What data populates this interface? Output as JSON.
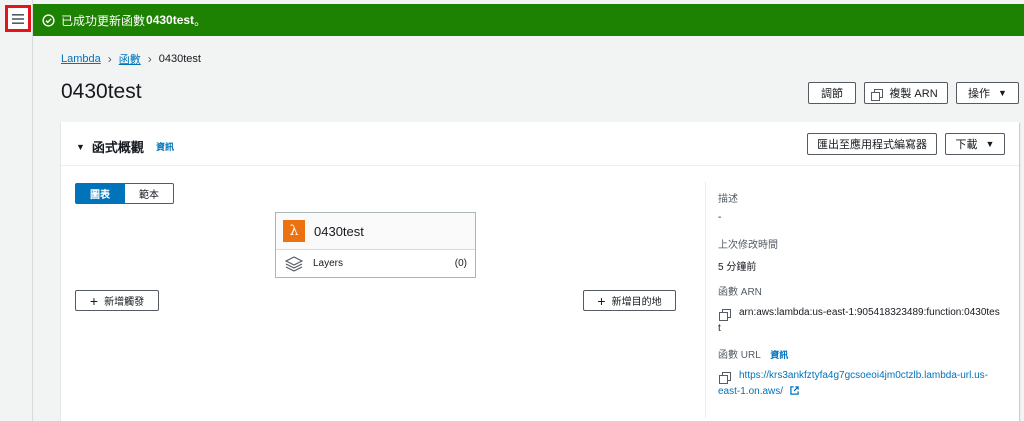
{
  "flash": {
    "message": "已成功更新函數",
    "function_name": "0430test",
    "suffix": "。"
  },
  "breadcrumb": {
    "root": "Lambda",
    "section": "函數",
    "current": "0430test"
  },
  "page": {
    "title": "0430test"
  },
  "header_actions": {
    "throttle": "調節",
    "copy_arn": "複製 ARN",
    "actions": "操作"
  },
  "overview": {
    "title": "函式概觀",
    "info": "資訊",
    "export_button": "匯出至應用程式編寫器",
    "download_button": "下載",
    "view_tabs": [
      "圖表",
      "範本"
    ],
    "function_card": {
      "name": "0430test",
      "layers_label": "Layers",
      "layers_count": "(0)"
    },
    "add_trigger": "新增觸發",
    "add_destination": "新增目的地"
  },
  "details": {
    "description_label": "描述",
    "description_value": "-",
    "last_modified_label": "上次修改時間",
    "last_modified_value": "5 分鐘前",
    "arn_label": "函數 ARN",
    "arn_line1": "arn:aws:lambda:us-east-1:905418323489:function:0430tes",
    "arn_line2": "t",
    "url_label": "函數 URL",
    "url_info": "資訊",
    "url_line1": "https://krs3ankfztyfa4g7gcsoeoi4jm0ctzlb.lambda-url.us-",
    "url_line2": "east-1.on.aws/"
  },
  "colors": {
    "success": "#1d8102",
    "link": "#0073bb",
    "lambda": "#ec7211",
    "highlight": "#e4141b"
  }
}
